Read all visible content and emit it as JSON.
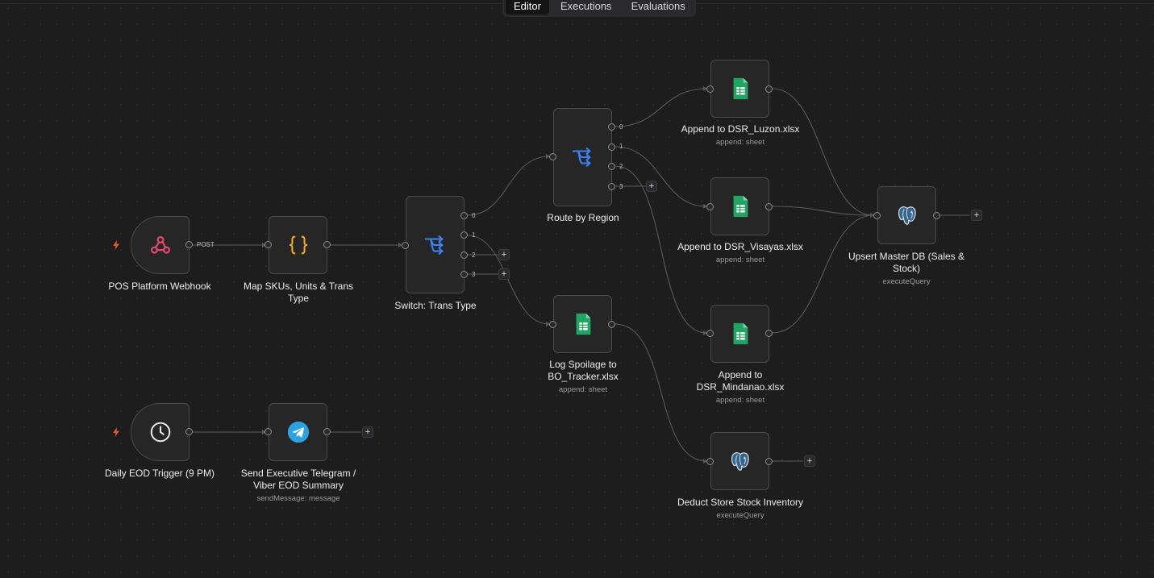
{
  "tabs": [
    {
      "label": "Editor",
      "active": true
    },
    {
      "label": "Executions",
      "active": false
    },
    {
      "label": "Evaluations",
      "active": false
    }
  ],
  "nodes": {
    "webhook": {
      "title": "POS Platform Webhook",
      "output_label": "POST",
      "icon": "webhook-icon"
    },
    "map": {
      "title": "Map SKUs, Units & Trans Type",
      "icon": "code-braces-icon"
    },
    "switch_trans": {
      "title": "Switch: Trans Type",
      "icon": "switch-icon",
      "outputs": [
        "0",
        "1",
        "2",
        "3"
      ]
    },
    "route_region": {
      "title": "Route by Region",
      "icon": "switch-icon",
      "outputs": [
        "0",
        "1",
        "2",
        "3"
      ]
    },
    "append_luzon": {
      "title": "Append to DSR_Luzon.xlsx",
      "subtitle": "append: sheet",
      "icon": "spreadsheet-icon"
    },
    "append_visayas": {
      "title": "Append to DSR_Visayas.xlsx",
      "subtitle": "append: sheet",
      "icon": "spreadsheet-icon"
    },
    "append_mindanao": {
      "title": "Append to DSR_Mindanao.xlsx",
      "subtitle": "append: sheet",
      "icon": "spreadsheet-icon"
    },
    "log_spoilage": {
      "title": "Log Spoilage to BO_Tracker.xlsx",
      "subtitle": "append: sheet",
      "icon": "spreadsheet-icon"
    },
    "upsert_master": {
      "title": "Upsert Master DB (Sales & Stock)",
      "subtitle": "executeQuery",
      "icon": "postgres-icon"
    },
    "deduct_stock": {
      "title": "Deduct Store Stock Inventory",
      "subtitle": "executeQuery",
      "icon": "postgres-icon"
    },
    "eod_trigger": {
      "title": "Daily EOD Trigger (9 PM)",
      "icon": "clock-icon"
    },
    "telegram": {
      "title": "Send Executive Telegram / Viber EOD Summary",
      "subtitle": "sendMessage: message",
      "icon": "telegram-icon"
    }
  },
  "plus_symbol": "+",
  "colors": {
    "background": "#1d1d1e",
    "node": "#262627",
    "wire": "#5a5a5c",
    "trigger_bolt": "#e8572a",
    "webhook": "#e2486f",
    "code": "#f5a623",
    "switch": "#3b82f6",
    "sheets": "#21a464",
    "telegram": "#2aa3e0",
    "postgres": "#336791"
  }
}
